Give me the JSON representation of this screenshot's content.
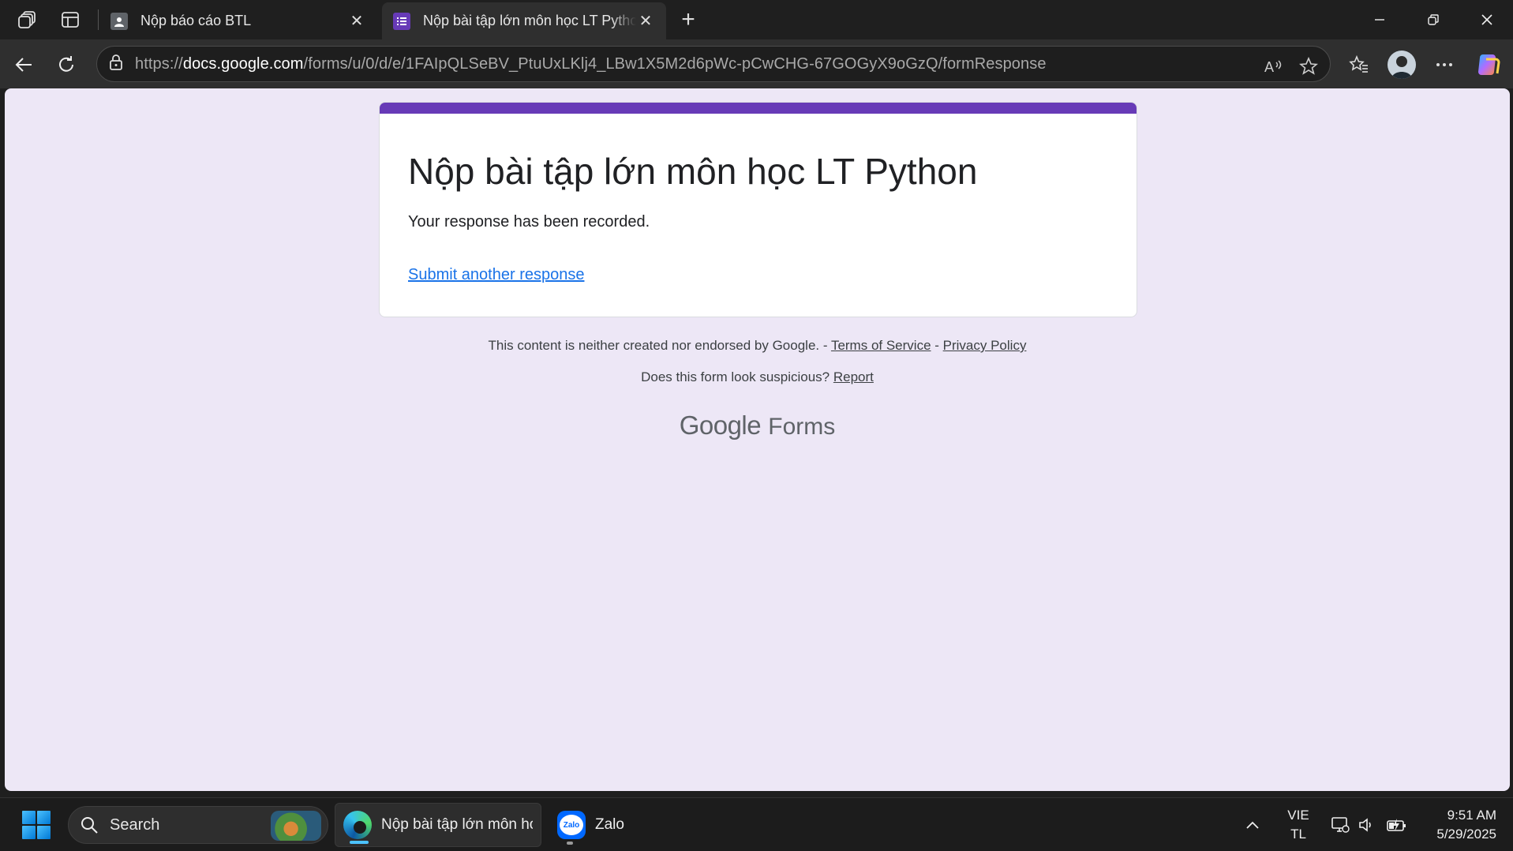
{
  "browser": {
    "tabs": [
      {
        "title": "Nộp báo cáo BTL",
        "active": false
      },
      {
        "title": "Nộp bài tập lớn môn học LT Python",
        "active": true
      }
    ],
    "address": {
      "scheme": "https://",
      "host": "docs.google.com",
      "path": "/forms/u/0/d/e/1FAIpQLSeBV_PtuUxLKlj4_LBw1X5M2d6pWc-pCwCHG-67GOGyX9oGzQ/formResponse"
    }
  },
  "form": {
    "title": "Nộp bài tập lớn môn học LT Python",
    "message": "Your response has been recorded.",
    "link": "Submit another response",
    "accent_color": "#673ab7"
  },
  "footer": {
    "disclaimer": "This content is neither created nor endorsed by Google. - ",
    "terms": "Terms of Service",
    "dash": " - ",
    "privacy": "Privacy Policy",
    "suspicious": "Does this form look suspicious? ",
    "report": "Report",
    "brand_google": "Google",
    "brand_forms": "Forms"
  },
  "taskbar": {
    "search_label": "Search",
    "apps": [
      {
        "label": "Nộp bài tập lớn môn học",
        "icon": "edge-icon"
      },
      {
        "label": "Zalo",
        "icon": "zalo-icon",
        "icon_text": "Zalo"
      }
    ],
    "lang_top": "VIE",
    "lang_bottom": "TL",
    "time": "9:51 AM",
    "date": "5/29/2025"
  }
}
